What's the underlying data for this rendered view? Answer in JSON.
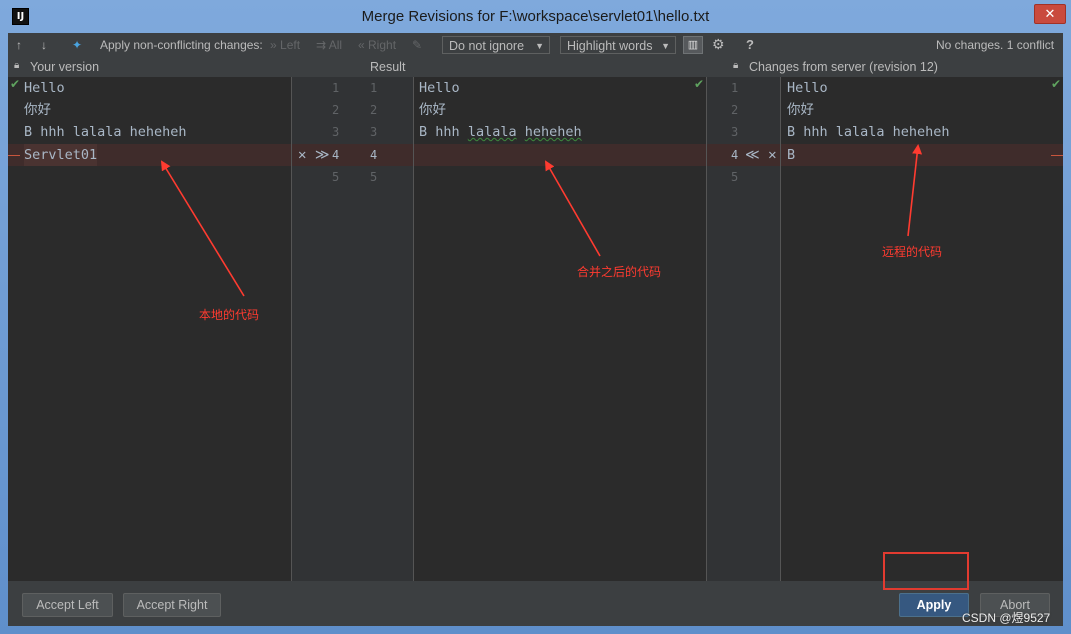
{
  "window": {
    "title": "Merge Revisions for F:\\workspace\\servlet01\\hello.txt",
    "app_icon_label": "IJ",
    "close_label": "✕"
  },
  "toolbar": {
    "prev_icon": "↑",
    "next_icon": "↓",
    "magic_icon": "✦",
    "apply_nonconflicting_label": "Apply non-conflicting changes:",
    "left_label": "Left",
    "all_label": "All",
    "right_label": "Right",
    "ignore_select": "Do not ignore",
    "highlight_select": "Highlight words",
    "toggle_icon": "▥",
    "settings_icon": "⚙",
    "help_icon": "?",
    "status": "No changes. 1 conflict"
  },
  "headers": {
    "left": "Your version",
    "center": "Result",
    "right": "Changes from server (revision 12)"
  },
  "left_pane": {
    "lines": [
      "Hello",
      "你好",
      "B hhh lalala heheheh",
      "Servlet01"
    ]
  },
  "result_pane": {
    "lines": [
      "Hello",
      "你好",
      "B hhh lalala heheheh",
      ""
    ]
  },
  "right_pane": {
    "lines": [
      "Hello",
      "你好",
      "B hhh lalala heheheh",
      "B"
    ]
  },
  "gutter": {
    "left_numbers": [
      "1",
      "2",
      "3",
      "4",
      "5"
    ],
    "result_numbers": [
      "1",
      "2",
      "3",
      "4",
      "5"
    ],
    "right_numbers": [
      "1",
      "2",
      "3",
      "4",
      "5"
    ],
    "left_conflict_actions": "✕ ≫",
    "right_conflict_actions": "≪ ✕"
  },
  "buttons": {
    "accept_left": "Accept Left",
    "accept_right": "Accept Right",
    "apply": "Apply",
    "abort": "Abort"
  },
  "annotations": {
    "local_code": "本地的代码",
    "merged_code": "合并之后的代码",
    "remote_code": "远程的代码"
  },
  "watermark": "CSDN @煜9527",
  "colors": {
    "editor_bg": "#2b2b2b",
    "conflict_bg": "#3f2c2b",
    "annotation_red": "#ff3b30",
    "apply_button": "#365880"
  }
}
